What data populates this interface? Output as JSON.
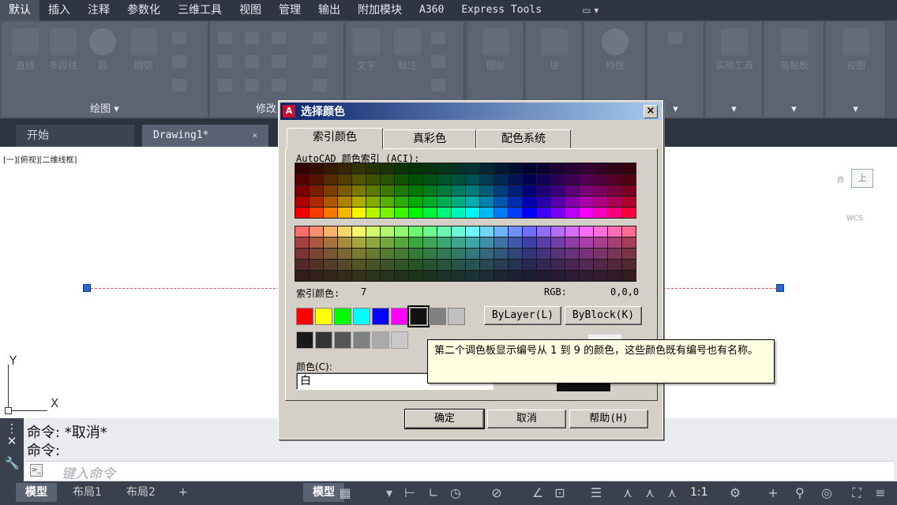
{
  "ribbon_tabs": [
    "默认",
    "插入",
    "注释",
    "参数化",
    "三维工具",
    "视图",
    "管理",
    "输出",
    "附加模块",
    "A360",
    "Express Tools"
  ],
  "ribbon_tools": {
    "draw": [
      "直线",
      "多段线",
      "圆",
      "圆弧"
    ],
    "annotation": [
      "文字",
      "标注"
    ],
    "layers": "图层",
    "block": "块",
    "properties": "特性",
    "utilities": "实用工具",
    "clipboard": "剪贴板",
    "view": "视图"
  },
  "panel_titles": {
    "draw": "绘图",
    "modify": "修改"
  },
  "file_tabs": {
    "start": "开始",
    "drawing": "Drawing1*",
    "close": "×"
  },
  "viewport_label": "[一][俯视][二维线框]",
  "viewcube": {
    "top": "上",
    "west": "西",
    "wcs": "WCS"
  },
  "ucs": {
    "x": "X",
    "y": "Y"
  },
  "command": {
    "history": [
      "命令: *取消*",
      "命令:"
    ],
    "placeholder": "键入命令"
  },
  "status": {
    "tabs": [
      "模型",
      "布局1",
      "布局2",
      "+"
    ],
    "model_label": "模型",
    "scale": "1:1"
  },
  "dialog": {
    "title": "选择颜色",
    "close": "×",
    "tabs": [
      "索引颜色",
      "真彩色",
      "配色系统"
    ],
    "aci_label": "AutoCAD 颜色索引 (ACI):",
    "index_color_label": "索引颜色:",
    "index_color_value": "7",
    "rgb_label": "RGB:",
    "rgb_value": "0,0,0",
    "bylayer": "ByLayer(L)",
    "byblock": "ByBlock(K)",
    "color_label": "颜色(C):",
    "color_value": "白",
    "ok": "确定",
    "cancel": "取消",
    "help": "帮助(H)",
    "standard_swatches": [
      "#ff0000",
      "#ffff00",
      "#00ff00",
      "#00ffff",
      "#0000ff",
      "#ff00ff",
      "#111111",
      "#808080",
      "#c0c0c0"
    ],
    "gray_swatches": [
      "#1a1a1a",
      "#333333",
      "#555555",
      "#808080",
      "#aaaaaa",
      "#c8c8c8"
    ]
  },
  "tooltip": "第二个调色板显示编号从 1 到 9 的颜色，这些颜色既有编号也有名称。"
}
